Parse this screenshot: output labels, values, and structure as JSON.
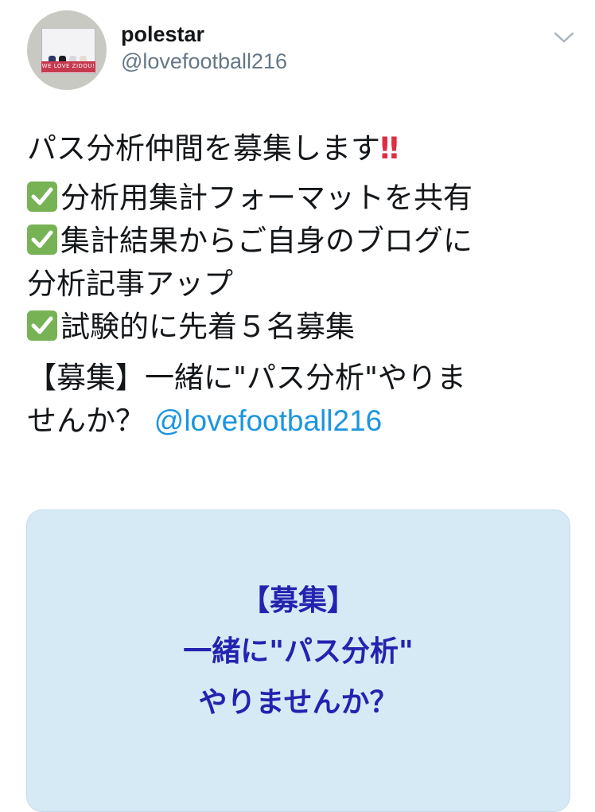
{
  "user": {
    "display_name": "polestar",
    "handle": "@lovefootball216",
    "avatar_caption": "WE LOVE ZIDOU!"
  },
  "icons": {
    "menu": "chevron-down-icon",
    "check": "white-check-mark-icon",
    "exclamation": "double-exclamation-icon"
  },
  "tweet": {
    "line1_text": "パス分析仲間を募集します",
    "line1_emoji": "‼",
    "items": [
      "分析用集計フォーマットを共有",
      "集計結果からご自身のブログに",
      "試験的に先着５名募集"
    ],
    "item2_continuation": "分析記事アップ",
    "link_line1": "【募集】一緒に\"パス分析\"やりま",
    "link_line2": "せんか？",
    "mention": "@lovefootball216"
  },
  "card": {
    "line1": "【募集】",
    "line2": "一緒に\"パス分析\"",
    "line3": "やりませんか？"
  },
  "colors": {
    "check_green": "#77b255",
    "link_blue": "#1b95e0",
    "card_bg": "#d6eaf5",
    "card_text": "#2323b0",
    "exclamation_red": "#dd2e44"
  }
}
